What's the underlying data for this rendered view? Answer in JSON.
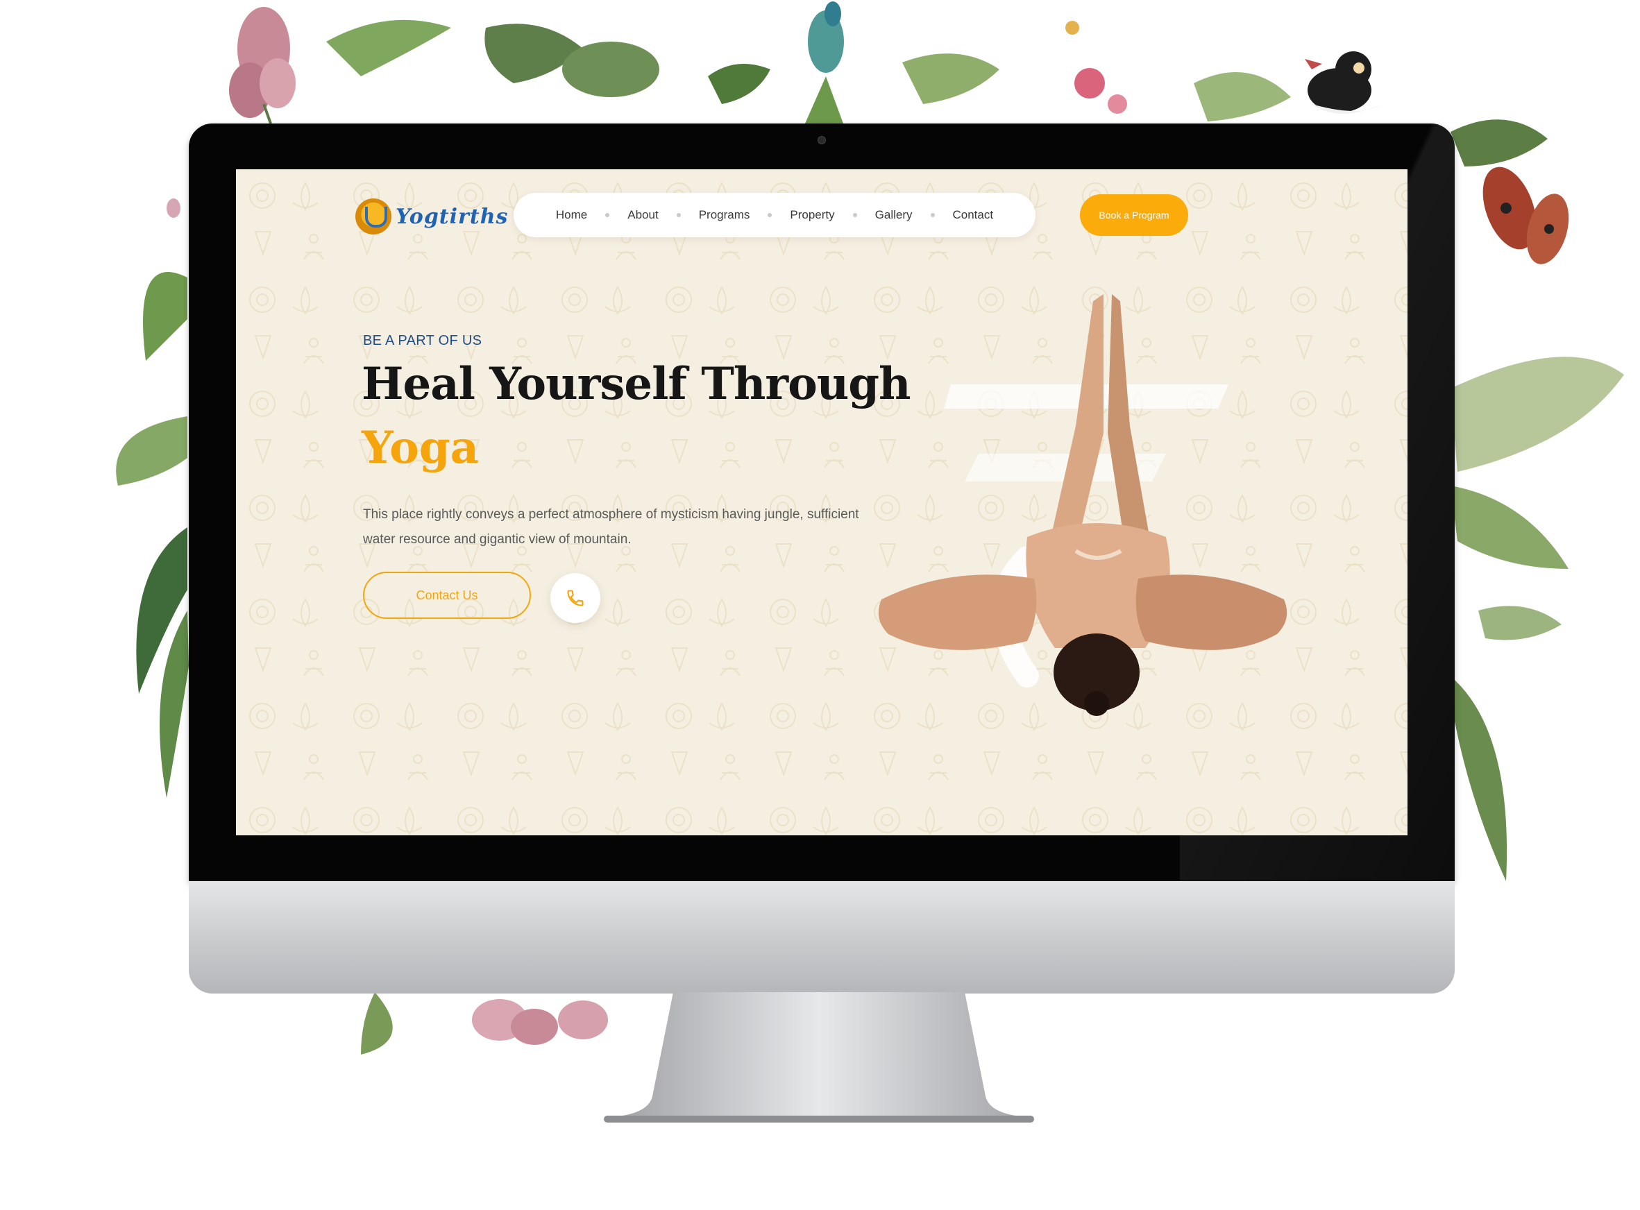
{
  "header": {
    "logo_text": "Yogtirths",
    "nav": [
      "Home",
      "About",
      "Programs",
      "Property",
      "Gallery",
      "Contact"
    ],
    "cta_label": "Book a Program"
  },
  "hero": {
    "eyebrow": "BE A PART OF US",
    "headline": "Heal Yourself Through",
    "headline_accent": "Yoga",
    "description": "This place rightly conveys a perfect atmosphere of mysticism having jungle, sufficient water resource and gigantic view of mountain.",
    "contact_label": "Contact Us",
    "phone_icon": "phone-icon",
    "image": "woman in yoga pose with hands joined overhead"
  },
  "colors": {
    "accent": "#F5A50B",
    "eyebrow": "#1F4D8C",
    "page_background": "#F5EFE2",
    "logo_blue": "#1E63B6"
  }
}
